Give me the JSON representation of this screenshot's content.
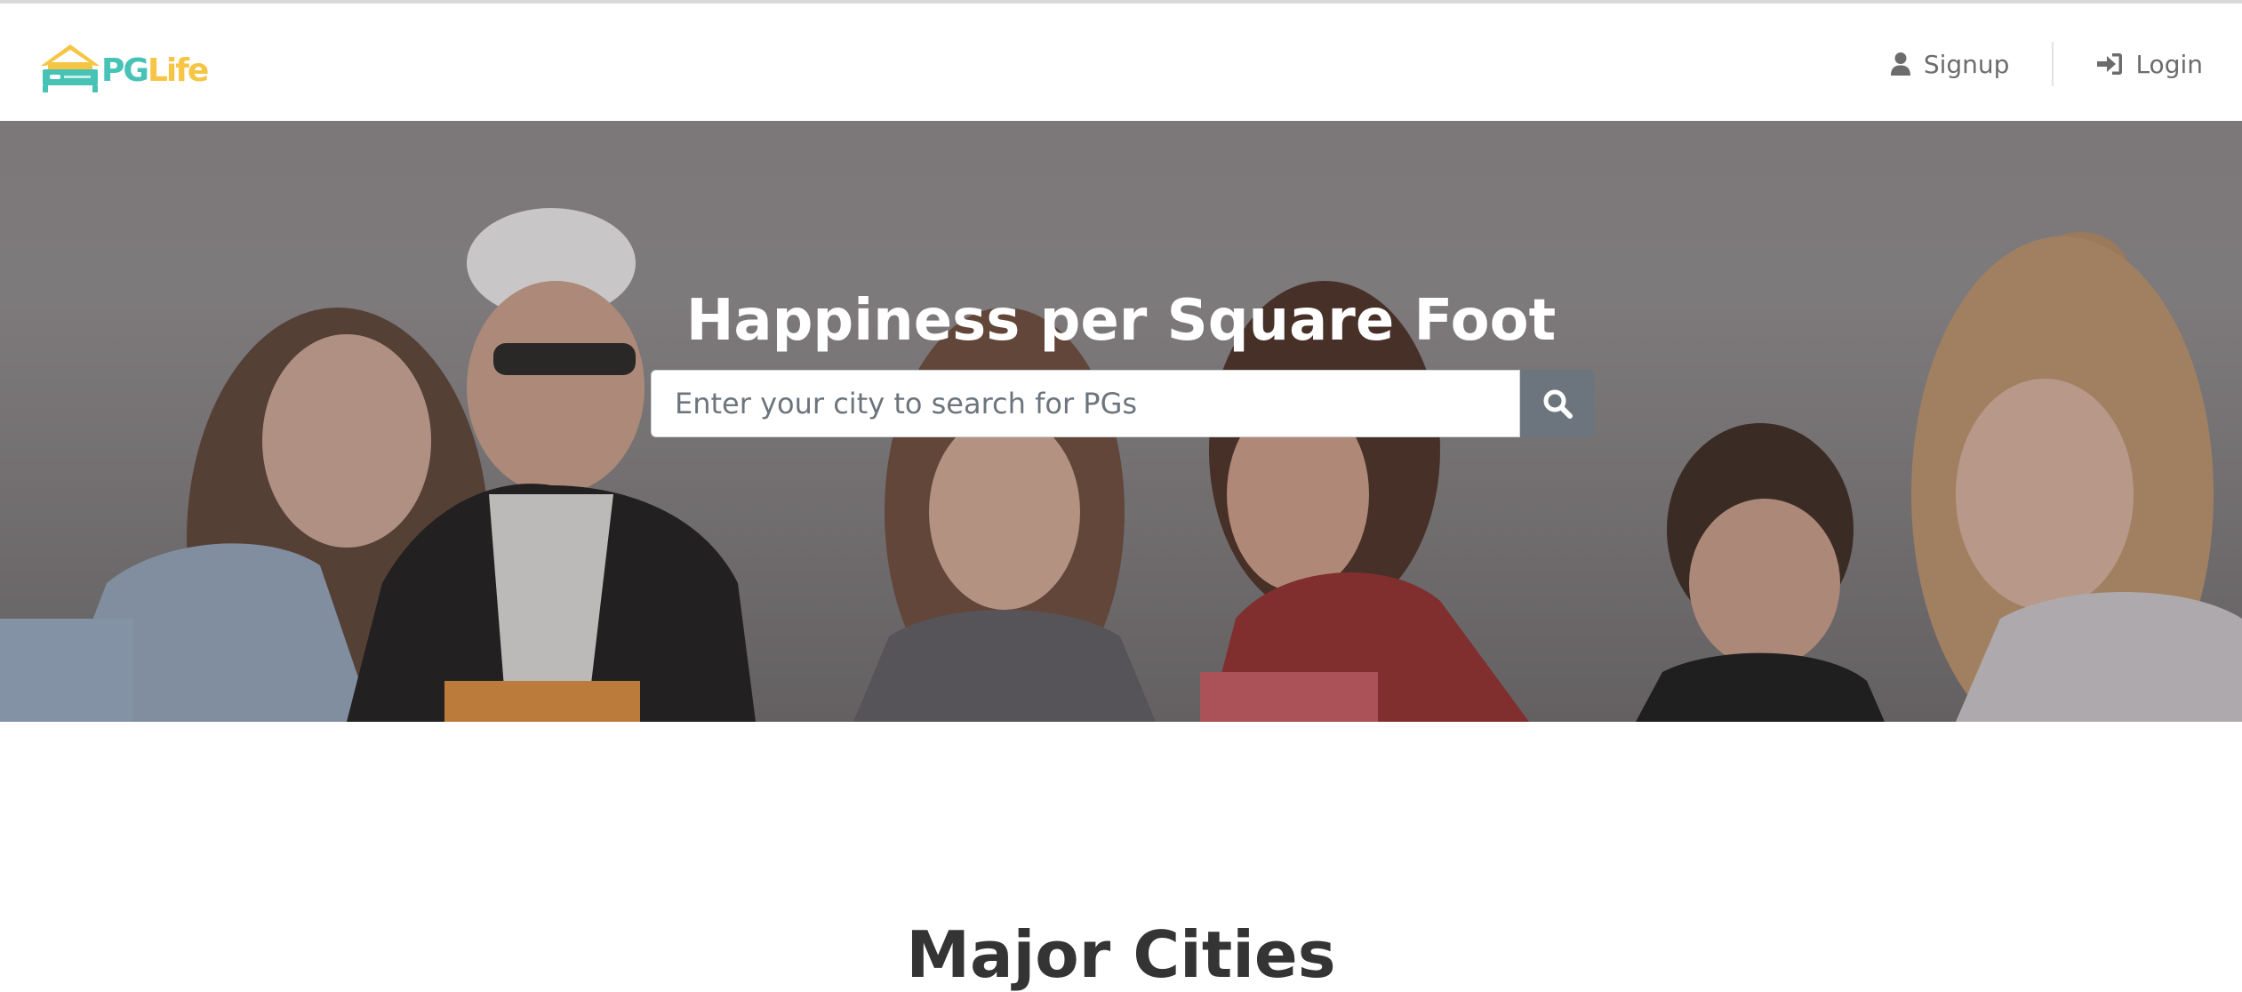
{
  "brand": {
    "name_part1": "PG",
    "name_part2": "Life",
    "primary_color": "#47c3b6",
    "accent_color": "#f6c544"
  },
  "nav": {
    "signup_label": "Signup",
    "signup_icon": "user-icon",
    "login_label": "Login",
    "login_icon": "sign-in-icon"
  },
  "hero": {
    "title": "Happiness per Square Foot",
    "search_placeholder": "Enter your city to search for PGs",
    "search_value": "",
    "search_icon": "search-icon"
  },
  "main": {
    "section_title": "Major Cities"
  }
}
